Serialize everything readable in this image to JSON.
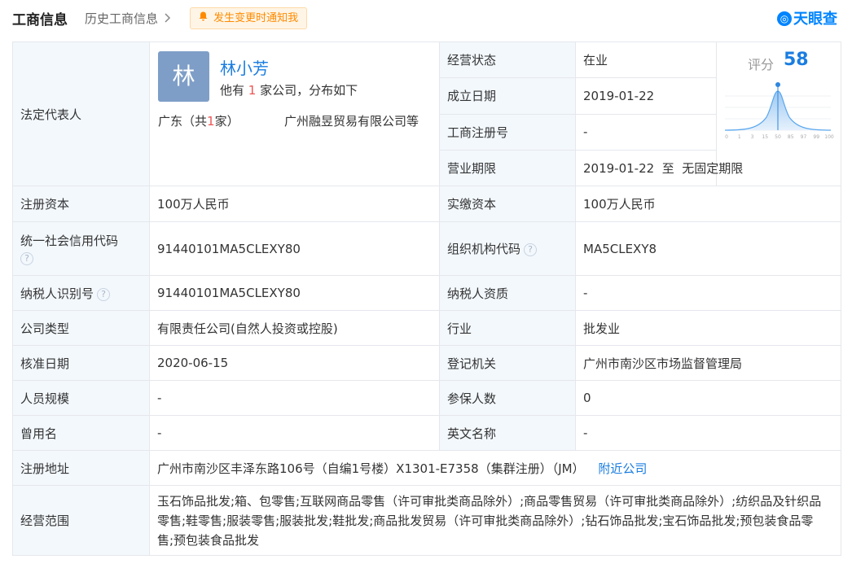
{
  "header": {
    "title": "工商信息",
    "history_link": "历史工商信息",
    "notify_button": "发生变更时通知我",
    "brand": "天眼查"
  },
  "representative": {
    "label": "法定代表人",
    "avatar_char": "林",
    "name": "林小芳",
    "sub_prefix": "他有 ",
    "sub_count": "1",
    "sub_suffix": " 家公司，分布如下",
    "region_prefix": "广东（共",
    "region_count": "1",
    "region_suffix": "家）",
    "company": "广州融昱贸易有限公司等"
  },
  "score": {
    "label": "评分",
    "value": "58",
    "ticks": [
      "0",
      "1",
      "3",
      "15",
      "50",
      "85",
      "97",
      "99",
      "100"
    ],
    "marker_percentile": 50
  },
  "fields": {
    "status_label": "经营状态",
    "status_value": "在业",
    "founded_label": "成立日期",
    "founded_value": "2019-01-22",
    "reg_no_label": "工商注册号",
    "reg_no_value": "-",
    "term_label": "营业期限",
    "term_value": "2019-01-22  至  无固定期限",
    "reg_capital_label": "注册资本",
    "reg_capital_value": "100万人民币",
    "paid_capital_label": "实缴资本",
    "paid_capital_value": "100万人民币",
    "credit_code_label": "统一社会信用代码",
    "credit_code_value": "91440101MA5CLEXY80",
    "org_code_label": "组织机构代码",
    "org_code_value": "MA5CLEXY8",
    "taxpayer_id_label": "纳税人识别号",
    "taxpayer_id_value": "91440101MA5CLEXY80",
    "taxpayer_qual_label": "纳税人资质",
    "taxpayer_qual_value": "-",
    "company_type_label": "公司类型",
    "company_type_value": "有限责任公司(自然人投资或控股)",
    "industry_label": "行业",
    "industry_value": "批发业",
    "approval_date_label": "核准日期",
    "approval_date_value": "2020-06-15",
    "authority_label": "登记机关",
    "authority_value": "广州市南沙区市场监督管理局",
    "staff_size_label": "人员规模",
    "staff_size_value": "-",
    "insured_label": "参保人数",
    "insured_value": "0",
    "former_name_label": "曾用名",
    "former_name_value": "-",
    "english_name_label": "英文名称",
    "english_name_value": "-",
    "address_label": "注册地址",
    "address_value": "广州市南沙区丰泽东路106号（自编1号楼）X1301-E7358（集群注册）（JM）",
    "nearby_link": "附近公司",
    "scope_label": "经营范围",
    "scope_value": "玉石饰品批发;箱、包零售;互联网商品零售（许可审批类商品除外）;商品零售贸易（许可审批类商品除外）;纺织品及针织品零售;鞋零售;服装零售;服装批发;鞋批发;商品批发贸易（许可审批类商品除外）;钻石饰品批发;宝石饰品批发;预包装食品零售;预包装食品批发"
  },
  "help_icon_glyph": "?",
  "colors": {
    "accent": "#1a7de0",
    "label_bg": "#f3f8fd",
    "notify": "#ff8a00",
    "avatar": "#7e9ec7"
  }
}
